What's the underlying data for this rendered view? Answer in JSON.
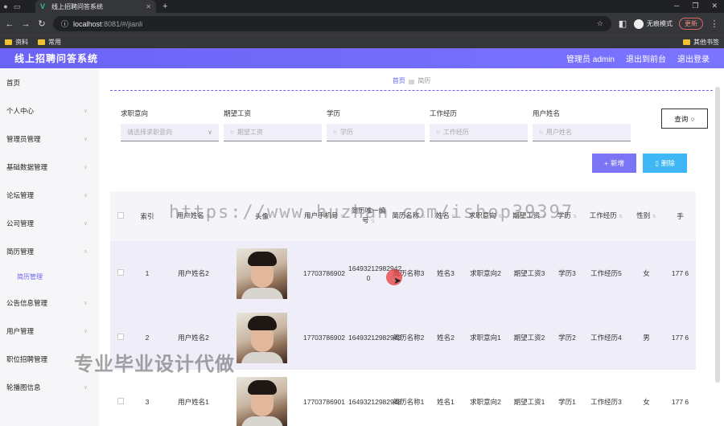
{
  "browser": {
    "tab_title": "线上招聘问答系统",
    "url_host": "localhost",
    "url_path": ":8081/#/jianli",
    "profile_label": "无痕模式",
    "update_label": "更新",
    "bookmarks": [
      "资料",
      "常用"
    ],
    "bookmarks_right": "其他书签"
  },
  "app": {
    "title": "线上招聘问答系统",
    "admin_label": "管理员 admin",
    "back_label": "退出到前台",
    "logout_label": "退出登录"
  },
  "sidebar": {
    "items": [
      {
        "label": "首页",
        "arrow": false
      },
      {
        "label": "个人中心",
        "arrow": true
      },
      {
        "label": "管理员管理",
        "arrow": true
      },
      {
        "label": "基础数据管理",
        "arrow": true
      },
      {
        "label": "论坛管理",
        "arrow": true
      },
      {
        "label": "公司管理",
        "arrow": true
      },
      {
        "label": "简历管理",
        "arrow": true
      },
      {
        "label": "公告信息管理",
        "arrow": true
      },
      {
        "label": "用户管理",
        "arrow": true
      },
      {
        "label": "职位招聘管理",
        "arrow": true
      },
      {
        "label": "轮播图信息",
        "arrow": true
      }
    ],
    "sub_item": "简历管理"
  },
  "breadcrumb": {
    "home": "首页",
    "current": "简历"
  },
  "filters": [
    {
      "label": "求职意向",
      "placeholder": "请选择求职意向",
      "select": true
    },
    {
      "label": "期望工资",
      "placeholder": "期望工资",
      "select": false
    },
    {
      "label": "学历",
      "placeholder": "学历",
      "select": false
    },
    {
      "label": "工作经历",
      "placeholder": "工作经历",
      "select": false
    },
    {
      "label": "用户姓名",
      "placeholder": "用户姓名",
      "select": false
    }
  ],
  "query_label": "查询",
  "add_label": "新增",
  "delete_label": "删除",
  "table": {
    "headers": [
      "索引",
      "用户姓名",
      "头像",
      "用户手机号",
      "简历唯一编号",
      "简历名称",
      "姓名",
      "求职意向",
      "期望工资",
      "学历",
      "工作经历",
      "性别",
      "手"
    ],
    "rows": [
      {
        "idx": "1",
        "user": "用户姓名2",
        "phone": "17703786902",
        "code": "16493212982942 0",
        "resume": "简历名称3",
        "name": "姓名3",
        "intent": "求职意向2",
        "salary": "期望工资3",
        "edu": "学历3",
        "exp": "工作经历5",
        "gender": "女",
        "more": "177 6"
      },
      {
        "idx": "2",
        "user": "用户姓名2",
        "phone": "17703786902",
        "code": "16493212982943",
        "resume": "简历名称2",
        "name": "姓名2",
        "intent": "求职意向1",
        "salary": "期望工资2",
        "edu": "学历2",
        "exp": "工作经历4",
        "gender": "男",
        "more": "177 6"
      },
      {
        "idx": "3",
        "user": "用户姓名1",
        "phone": "17703786901",
        "code": "16493212982948",
        "resume": "简历名称1",
        "name": "姓名1",
        "intent": "求职意向2",
        "salary": "期望工资1",
        "edu": "学历1",
        "exp": "工作经历3",
        "gender": "女",
        "more": "177 6"
      }
    ]
  },
  "overlay": {
    "watermark_url": "https://www.huzhan.com/ishop39397",
    "watermark_text": "专业毕业设计代做"
  }
}
